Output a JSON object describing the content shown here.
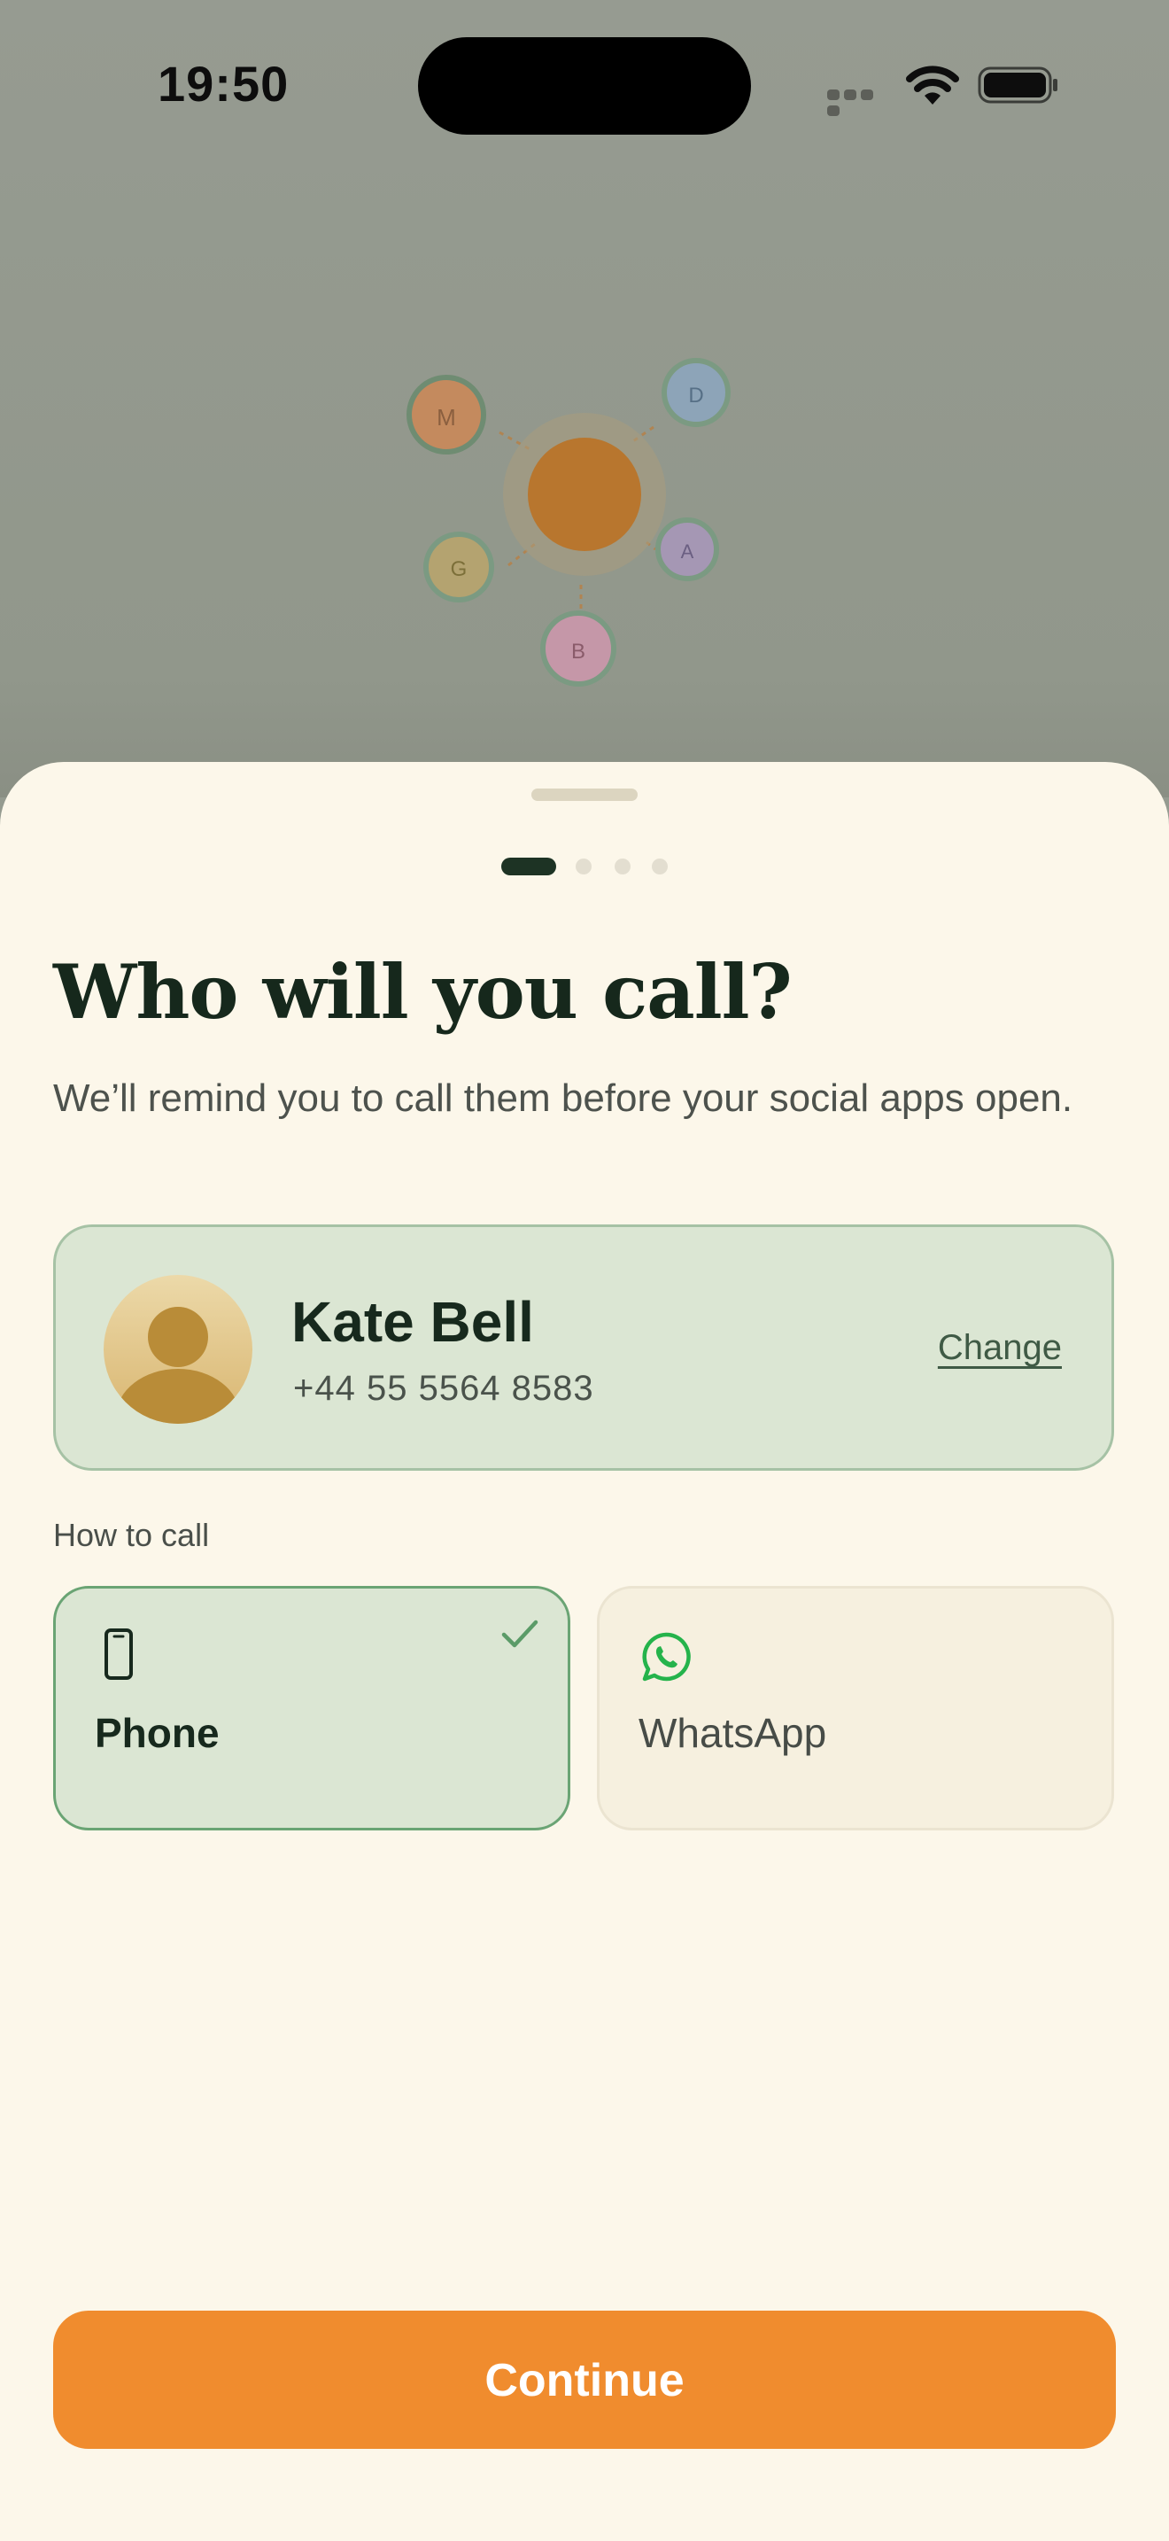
{
  "status_bar": {
    "time": "19:50"
  },
  "network": {
    "nodes": [
      {
        "initial": "M",
        "color": "#c48a5e"
      },
      {
        "initial": "D",
        "color": "#8da4b8"
      },
      {
        "initial": "G",
        "color": "#b4a370"
      },
      {
        "initial": "A",
        "color": "#a597b4"
      },
      {
        "initial": "B",
        "color": "#c597a8"
      }
    ],
    "center_color": "#b8762e"
  },
  "onboarding": {
    "page_index": 1,
    "page_count": 4,
    "title": "Who will you call?",
    "subtitle": "We’ll remind you to call them before your social apps open."
  },
  "contact": {
    "name": "Kate Bell",
    "phone": "+44 55 5564 8583",
    "change_label": "Change"
  },
  "call_method": {
    "label": "How to call",
    "options": [
      {
        "label": "Phone",
        "icon": "phone-icon",
        "selected": true
      },
      {
        "label": "WhatsApp",
        "icon": "whatsapp-icon",
        "selected": false
      }
    ]
  },
  "continue_label": "Continue",
  "colors": {
    "accent": "#f08c2e",
    "selected_bg": "#dbe6d3",
    "selected_border": "#6aa474",
    "sheet_bg": "#fcf7ea",
    "whatsapp_green": "#25b34b"
  }
}
